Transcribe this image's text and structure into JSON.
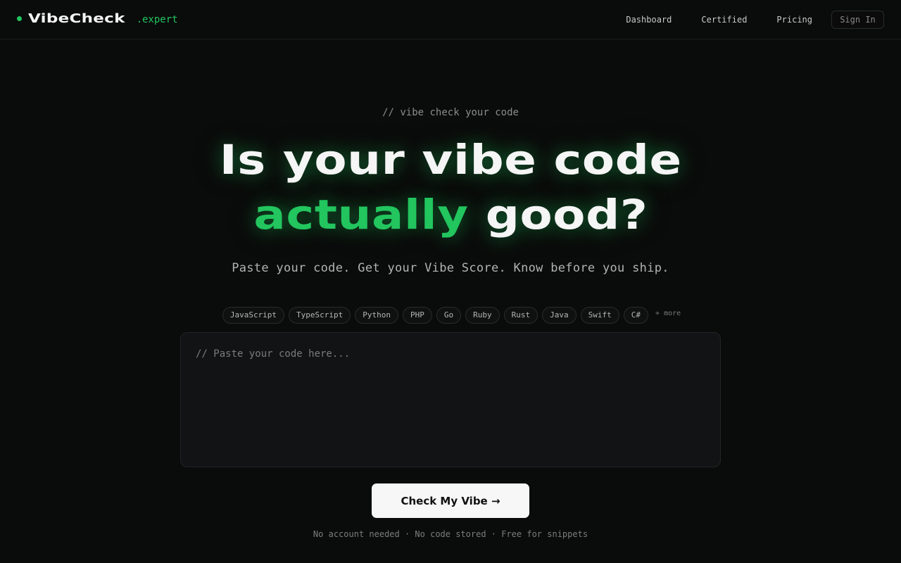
{
  "brand": {
    "name": "VibeCheck",
    "tld": ".expert",
    "accent_color": "#22c55e"
  },
  "nav": {
    "links": [
      {
        "label": "Dashboard"
      },
      {
        "label": "Certified"
      },
      {
        "label": "Pricing"
      }
    ],
    "signin_label": "Sign In"
  },
  "hero": {
    "eyebrow": "// vibe check your code",
    "headline_line1": "Is your vibe code",
    "headline_accent": "actually",
    "headline_rest": "good?",
    "subhead": "Paste your code. Get your Vibe Score. Know before you ship."
  },
  "languages": {
    "items": [
      "JavaScript",
      "TypeScript",
      "Python",
      "PHP",
      "Go",
      "Ruby",
      "Rust",
      "Java",
      "Swift",
      "C#"
    ],
    "more_label": "+ more"
  },
  "editor": {
    "placeholder": "// Paste your code here..."
  },
  "cta": {
    "label": "Check My Vibe →"
  },
  "footnote": "No account needed · No code stored · Free for snippets"
}
